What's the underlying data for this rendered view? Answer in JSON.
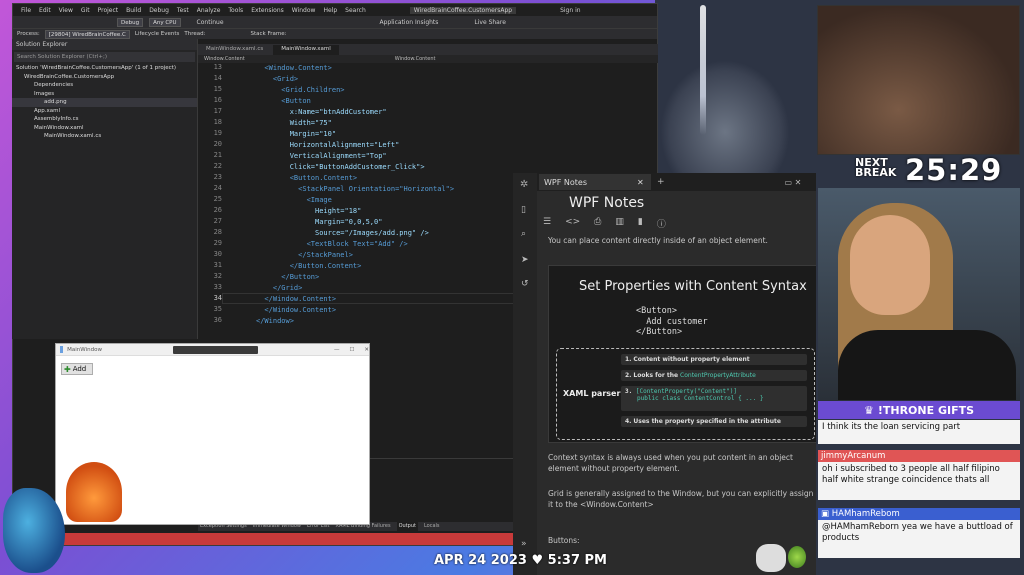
{
  "vs": {
    "menu": [
      "File",
      "Edit",
      "View",
      "Git",
      "Project",
      "Build",
      "Debug",
      "Test",
      "Analyze",
      "Tools",
      "Extensions",
      "Window",
      "Help",
      "Search"
    ],
    "window_title": "WiredBrainCoffee.CustomersApp",
    "sign_in": "Sign in",
    "live_share": "Live Share",
    "toolbar": {
      "config": "Debug",
      "platform": "Any CPU",
      "continue": "Continue",
      "app_insights": "Application Insights"
    },
    "process_bar": {
      "label": "Process:",
      "process": "[29804] WiredBrainCoffee.C",
      "lifecycle": "Lifecycle Events",
      "thread": "Thread:",
      "stack_frame": "Stack Frame:"
    },
    "solution_explorer": {
      "title": "Solution Explorer",
      "search_placeholder": "Search Solution Explorer (Ctrl+;)",
      "items": [
        "Solution 'WiredBrainCoffee.CustomersApp' (1 of 1 project)",
        "WiredBrainCoffee.CustomersApp",
        "Dependencies",
        "Images",
        "add.png",
        "App.xaml",
        "AssemblyInfo.cs",
        "MainWindow.xaml",
        "MainWindow.xaml.cs"
      ]
    },
    "tabs": [
      "MainWindow.xaml.cs",
      "MainWindow.xaml"
    ],
    "crumbs": [
      "Window.Content",
      "Window.Content"
    ],
    "editor": {
      "line_numbers": [
        "13",
        "14",
        "15",
        "16",
        "17",
        "18",
        "19",
        "20",
        "21",
        "22",
        "23",
        "24",
        "25",
        "26",
        "27",
        "28",
        "29",
        "30",
        "31",
        "32",
        "33",
        "34",
        "35",
        "36"
      ],
      "current_line": "34"
    },
    "output_tabs": [
      "Exception Settings",
      "Immediate Window",
      "Error List",
      "XAML Binding Failures",
      "Output",
      "Locals"
    ]
  },
  "wpf_window": {
    "title": "MainWindow",
    "button_label": "Add"
  },
  "notes": {
    "tab_title": "WPF Notes",
    "title": "WPF Notes",
    "intro": "You can place content directly inside of an object element.",
    "card_title": "Set Properties with Content Syntax",
    "card_code_lines": [
      "<Button>",
      "  Add customer",
      "</Button>"
    ],
    "parser_label": "XAML parser",
    "steps": [
      {
        "num": "1.",
        "text": "Content without property element"
      },
      {
        "num": "2.",
        "text": "Looks for the",
        "highlight": "ContentPropertyAttribute"
      },
      {
        "num": "3.",
        "code1": "[ContentProperty(\"Content\")]",
        "code2": "public class ContentControl { ... }"
      },
      {
        "num": "4.",
        "text": "Uses the property specified in the attribute"
      }
    ],
    "para1": "Context syntax is always used when you put content in an object element without property element.",
    "para2": "Grid is generally assigned to the Window, but you can explicitly assign it to the <Window.Content>",
    "para3": "Buttons:"
  },
  "overlay": {
    "next_break_1": "NEXT",
    "next_break_2": "BREAK",
    "timer": "25:29",
    "throne": "!THRONE GIFTS",
    "chat": [
      {
        "user": "",
        "text": "I think its the loan servicing part"
      },
      {
        "user": "jimmyArcanum",
        "text": "oh i subscribed to 3 people all half filipino half white strange coincidence thats all"
      },
      {
        "user": "HAMhamRebom",
        "text": "@HAMhamReborn yea we have a buttload of products"
      }
    ],
    "date": "APR 24 2023",
    "time": "5:37 PM"
  }
}
